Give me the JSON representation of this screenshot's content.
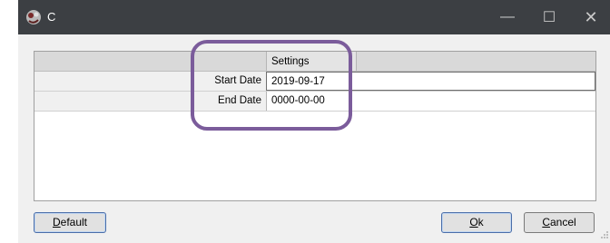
{
  "window": {
    "title": "C"
  },
  "title_controls": {
    "minimize": "—",
    "maximize": "☐",
    "close": "✕"
  },
  "grid": {
    "header": "Settings",
    "rows": [
      {
        "label": "Start Date",
        "value": "2019-09-17"
      },
      {
        "label": "End Date",
        "value": "0000-00-00"
      }
    ]
  },
  "buttons": {
    "default": {
      "mnemonic": "D",
      "rest": "efault"
    },
    "ok": {
      "mnemonic": "O",
      "rest": "k"
    },
    "cancel": {
      "mnemonic": "C",
      "rest": "ancel"
    }
  },
  "colors": {
    "titlebar": "#3c3f43",
    "highlight": "#7b5c9b"
  }
}
